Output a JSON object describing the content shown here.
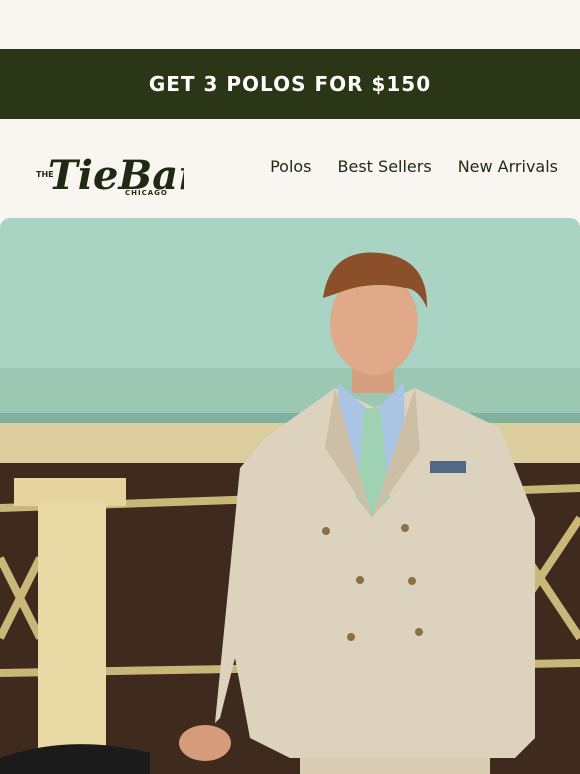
{
  "promo": {
    "text": "GET 3 POLOS FOR $150"
  },
  "logo": {
    "small": "THE",
    "brand": "TieBar",
    "city": "CHICAGO"
  },
  "nav": {
    "items": [
      "Polos",
      "Best Sellers",
      "New Arrivals"
    ]
  },
  "colors": {
    "page_bg": "#f9f6f2",
    "promo_bg": "#2a3616",
    "brand_text": "#1f2a12"
  }
}
